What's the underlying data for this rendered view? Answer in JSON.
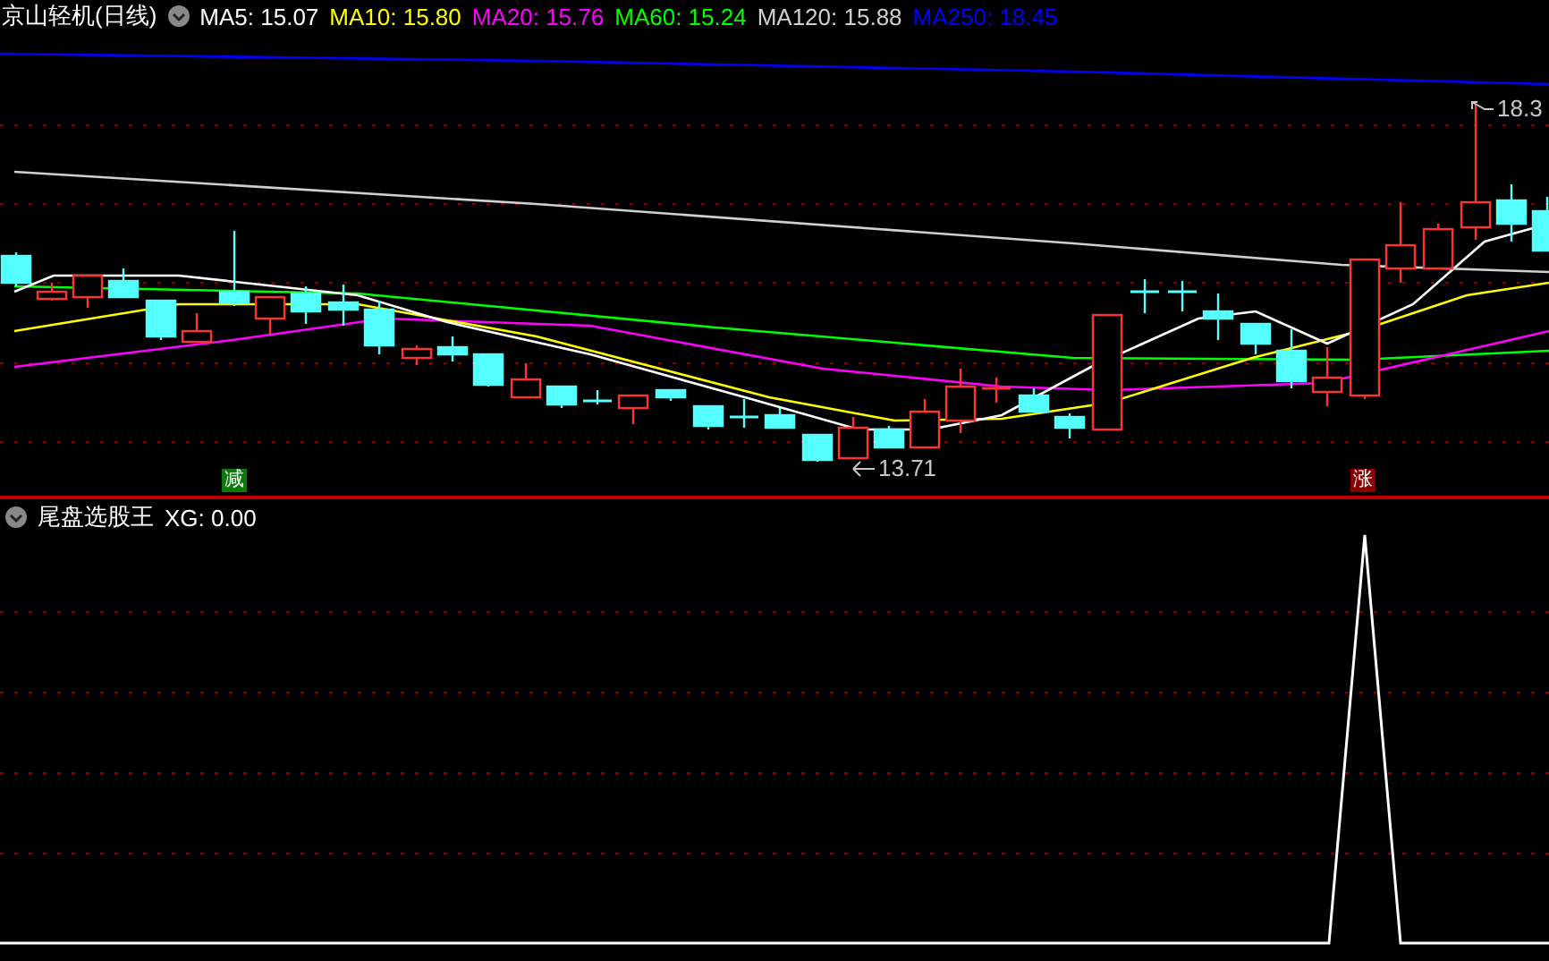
{
  "header": {
    "title": "京山轻机(日线)",
    "legend": [
      {
        "label": "MA5: 15.07",
        "color": "#ffffff"
      },
      {
        "label": "MA10: 15.80",
        "color": "#ffff00"
      },
      {
        "label": "MA20: 15.76",
        "color": "#ff00ff"
      },
      {
        "label": "MA60: 15.24",
        "color": "#00ff00"
      },
      {
        "label": "MA120: 15.88",
        "color": "#d0d0d0"
      },
      {
        "label": "MA250: 18.45",
        "color": "#0000ff"
      }
    ]
  },
  "price_labels": [
    {
      "kind": "high",
      "text": "18.3"
    },
    {
      "kind": "low",
      "text": "13.71"
    }
  ],
  "signals": [
    {
      "kind": "sell",
      "text": "减"
    },
    {
      "kind": "buy",
      "text": "涨"
    }
  ],
  "indicator": {
    "title": "尾盘选股王",
    "reading": "XG: 0.00"
  }
}
